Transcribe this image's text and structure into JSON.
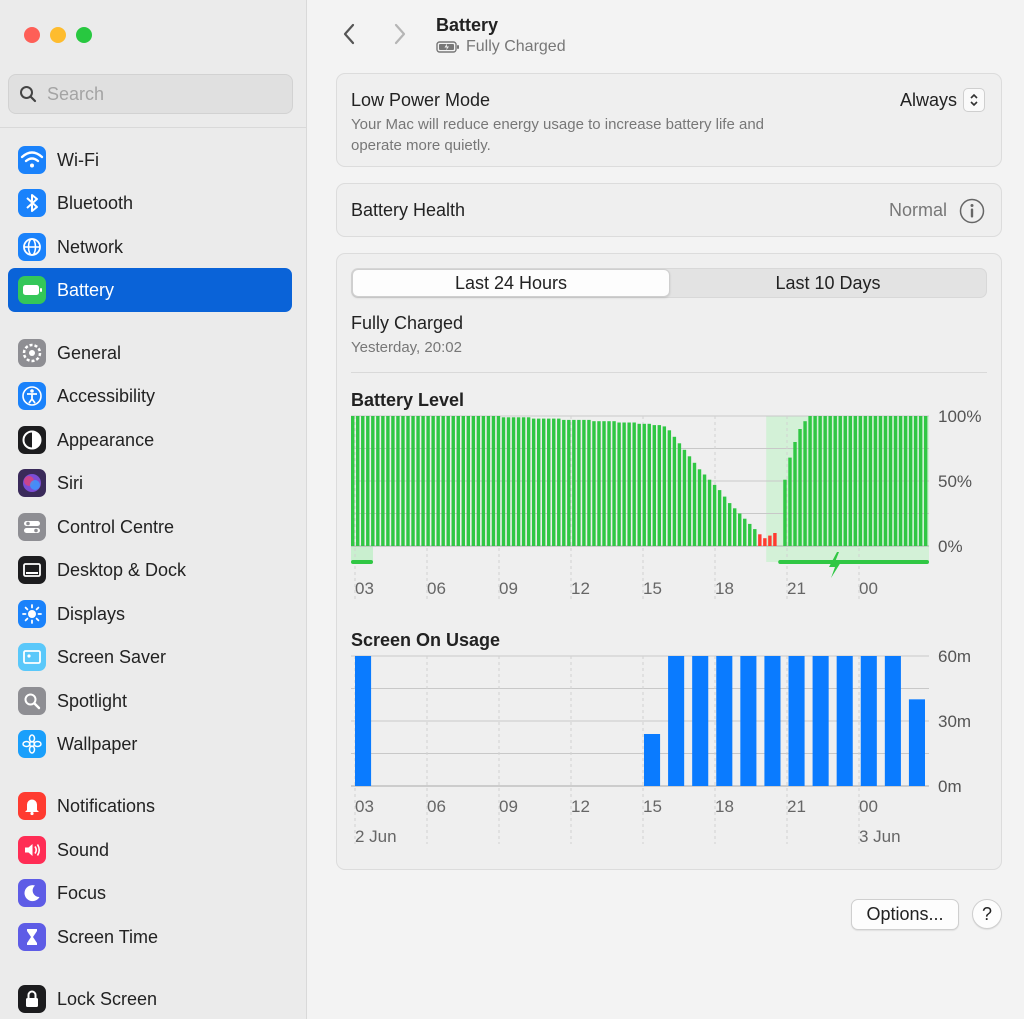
{
  "window": {
    "controls": [
      "close",
      "minimize",
      "zoom"
    ]
  },
  "search": {
    "placeholder": "Search"
  },
  "sidebar": {
    "items": [
      {
        "label": "Wi-Fi",
        "icon": "wifi-icon",
        "color": "#1a82fb"
      },
      {
        "label": "Bluetooth",
        "icon": "bluetooth-icon",
        "color": "#1a82fb"
      },
      {
        "label": "Network",
        "icon": "globe-icon",
        "color": "#1a82fb"
      },
      {
        "label": "Battery",
        "icon": "battery-icon",
        "color": "#34c759",
        "active": true
      },
      {
        "label": "General",
        "icon": "gear-icon",
        "color": "#8e8e93"
      },
      {
        "label": "Accessibility",
        "icon": "accessibility-icon",
        "color": "#1a82fb"
      },
      {
        "label": "Appearance",
        "icon": "appearance-icon",
        "color": "#1c1c1e"
      },
      {
        "label": "Siri",
        "icon": "siri-icon",
        "color": "#3a2a5a"
      },
      {
        "label": "Control Centre",
        "icon": "toggles-icon",
        "color": "#8e8e93"
      },
      {
        "label": "Desktop & Dock",
        "icon": "dock-icon",
        "color": "#1c1c1e"
      },
      {
        "label": "Displays",
        "icon": "sun-icon",
        "color": "#1a82fb"
      },
      {
        "label": "Screen Saver",
        "icon": "screen-saver-icon",
        "color": "#5ac8fa"
      },
      {
        "label": "Spotlight",
        "icon": "magnifier-icon",
        "color": "#8e8e93"
      },
      {
        "label": "Wallpaper",
        "icon": "flower-icon",
        "color": "#1a9ffb"
      },
      {
        "label": "Notifications",
        "icon": "bell-icon",
        "color": "#ff3b30"
      },
      {
        "label": "Sound",
        "icon": "speaker-icon",
        "color": "#ff2d55"
      },
      {
        "label": "Focus",
        "icon": "moon-icon",
        "color": "#5e5ce6"
      },
      {
        "label": "Screen Time",
        "icon": "hourglass-icon",
        "color": "#5e5ce6"
      },
      {
        "label": "Lock Screen",
        "icon": "lock-icon",
        "color": "#1c1c1e"
      }
    ]
  },
  "header": {
    "title": "Battery",
    "status": "Fully Charged"
  },
  "low_power": {
    "title": "Low Power Mode",
    "description_line1": "Your Mac will reduce energy usage to increase battery life and",
    "description_line2": "operate more quietly.",
    "value": "Always"
  },
  "health": {
    "title": "Battery Health",
    "value": "Normal"
  },
  "usage": {
    "tabs": [
      "Last 24 Hours",
      "Last 10 Days"
    ],
    "active_tab": 0,
    "last_charge_title": "Fully Charged",
    "last_charge_time": "Yesterday, 20:02"
  },
  "buttons": {
    "options": "Options...",
    "help": "?"
  },
  "colors": {
    "battery_bar": "#30c744",
    "low_bar": "#ff3b30",
    "charging": "#30c744",
    "screen_bar": "#0a7bff",
    "accent": "#0a63d8"
  },
  "chart_data": [
    {
      "type": "bar",
      "title": "Battery Level",
      "x_ticks": [
        "03",
        "06",
        "09",
        "12",
        "15",
        "18",
        "21",
        "00"
      ],
      "y_ticks": [
        "100%",
        "50%",
        "0%"
      ],
      "ylim": [
        0,
        100
      ],
      "values": [
        100,
        100,
        100,
        100,
        100,
        100,
        100,
        100,
        100,
        100,
        100,
        100,
        100,
        100,
        100,
        100,
        100,
        100,
        100,
        100,
        100,
        100,
        100,
        100,
        100,
        100,
        100,
        100,
        100,
        100,
        99,
        99,
        99,
        99,
        99,
        99,
        98,
        98,
        98,
        98,
        98,
        98,
        97,
        97,
        97,
        97,
        97,
        97,
        96,
        96,
        96,
        96,
        96,
        95,
        95,
        95,
        95,
        94,
        94,
        94,
        93,
        93,
        92,
        89,
        84,
        79,
        74,
        69,
        64,
        59,
        55,
        51,
        47,
        43,
        38,
        33,
        29,
        25,
        21,
        17,
        13,
        9,
        6,
        8,
        10,
        0,
        51,
        68,
        80,
        90,
        96,
        100,
        100,
        100,
        100,
        100,
        100,
        100,
        100,
        100,
        100,
        100,
        100,
        100,
        100,
        100,
        100,
        100,
        100,
        100,
        100,
        100,
        100,
        100,
        100
      ],
      "low_bar_indices": [
        81,
        82,
        83,
        84
      ],
      "charging_start_index": 85,
      "grid": true
    },
    {
      "type": "bar",
      "title": "Screen On Usage",
      "x_ticks": [
        "03",
        "06",
        "09",
        "12",
        "15",
        "18",
        "21",
        "00"
      ],
      "date_labels": [
        "2 Jun",
        "3 Jun"
      ],
      "y_ticks": [
        "60m",
        "30m",
        "0m"
      ],
      "ylim": [
        0,
        60
      ],
      "unit": "minutes",
      "values": [
        60,
        0,
        0,
        0,
        0,
        0,
        0,
        0,
        0,
        0,
        0,
        0,
        24,
        60,
        60,
        60,
        60,
        60,
        60,
        60,
        60,
        60,
        60,
        40
      ],
      "grid": true
    }
  ]
}
